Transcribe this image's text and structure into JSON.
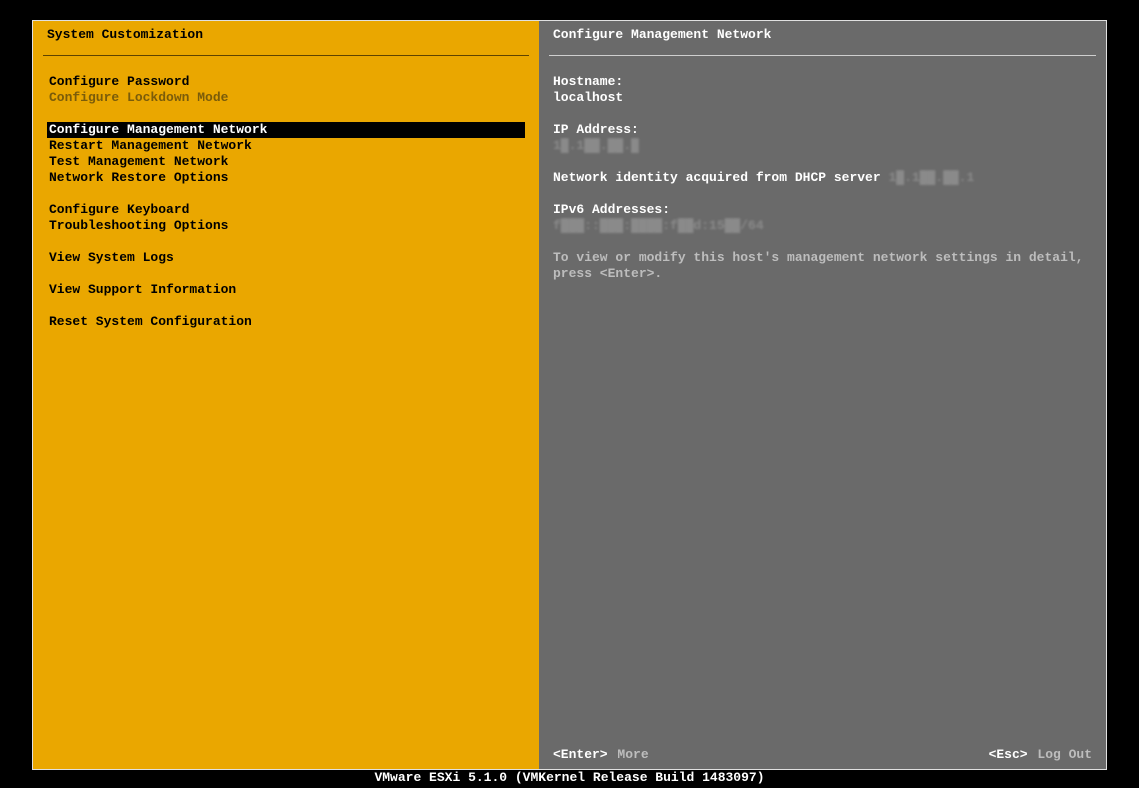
{
  "left": {
    "title": "System Customization",
    "groups": [
      [
        {
          "label": "Configure Password",
          "state": "normal"
        },
        {
          "label": "Configure Lockdown Mode",
          "state": "disabled"
        }
      ],
      [
        {
          "label": "Configure Management Network",
          "state": "selected"
        },
        {
          "label": "Restart Management Network",
          "state": "normal"
        },
        {
          "label": "Test Management Network",
          "state": "normal"
        },
        {
          "label": "Network Restore Options",
          "state": "normal"
        }
      ],
      [
        {
          "label": "Configure Keyboard",
          "state": "normal"
        },
        {
          "label": "Troubleshooting Options",
          "state": "normal"
        }
      ],
      [
        {
          "label": "View System Logs",
          "state": "normal"
        }
      ],
      [
        {
          "label": "View Support Information",
          "state": "normal"
        }
      ],
      [
        {
          "label": "Reset System Configuration",
          "state": "normal"
        }
      ]
    ]
  },
  "right": {
    "title": "Configure Management Network",
    "hostname_label": "Hostname:",
    "hostname_value": "localhost",
    "ip_label": "IP Address:",
    "ip_value": "1█.1██.██.█",
    "dhcp_line_prefix": "Network identity acquired from DHCP server ",
    "dhcp_server": "1█.1██.██.1",
    "ipv6_label": "IPv6 Addresses:",
    "ipv6_value": "f███::███:████:f██d:15██/64",
    "help_text": "To view or modify this host's management network settings in detail, press <Enter>."
  },
  "footer": {
    "enter_key": "<Enter>",
    "enter_action": "More",
    "esc_key": "<Esc>",
    "esc_action": "Log Out"
  },
  "product_line": "VMware ESXi 5.1.0 (VMKernel Release Build 1483097)"
}
